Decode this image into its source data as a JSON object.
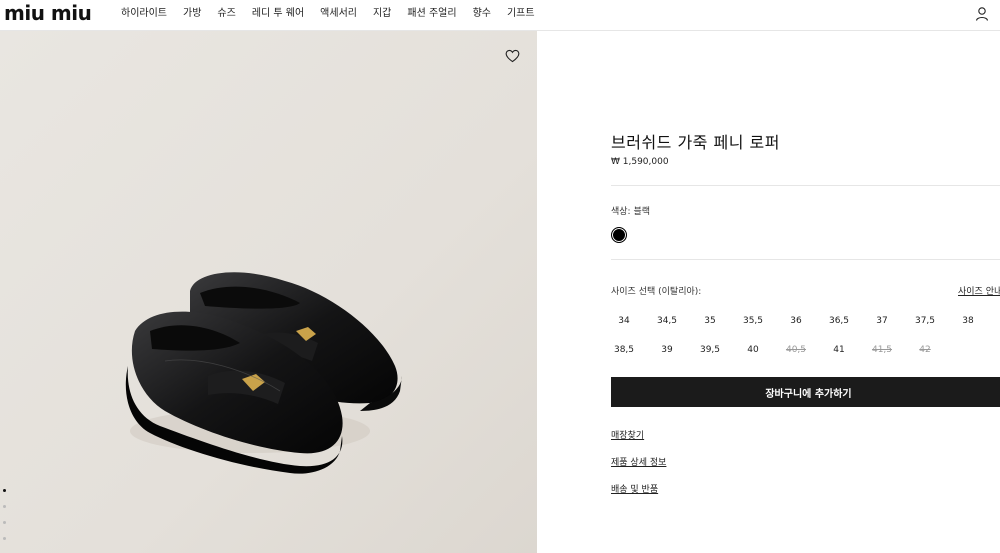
{
  "header": {
    "logo": "miu miu",
    "nav": [
      "하이라이트",
      "가방",
      "슈즈",
      "레디 투 웨어",
      "액세서리",
      "지갑",
      "패션 주얼리",
      "향수",
      "기프트"
    ]
  },
  "product": {
    "title": "브러쉬드 가죽 페니 로퍼",
    "price": "₩ 1,590,000",
    "color_label": "색상: 블랙",
    "color_hex": "#000000",
    "size_label": "사이즈 선택 (이탈리아):",
    "size_guide": "사이즈 안내",
    "sizes": [
      {
        "label": "34",
        "available": true
      },
      {
        "label": "34,5",
        "available": true
      },
      {
        "label": "35",
        "available": true
      },
      {
        "label": "35,5",
        "available": true
      },
      {
        "label": "36",
        "available": true
      },
      {
        "label": "36,5",
        "available": true
      },
      {
        "label": "37",
        "available": true
      },
      {
        "label": "37,5",
        "available": true
      },
      {
        "label": "38",
        "available": true
      },
      {
        "label": "38,5",
        "available": true
      },
      {
        "label": "39",
        "available": true
      },
      {
        "label": "39,5",
        "available": true
      },
      {
        "label": "40",
        "available": true
      },
      {
        "label": "40,5",
        "available": false
      },
      {
        "label": "41",
        "available": true
      },
      {
        "label": "41,5",
        "available": false
      },
      {
        "label": "42",
        "available": false
      }
    ],
    "add_to_cart": "장바구니에 추가하기",
    "links": [
      "매장찾기",
      "제품 상세 정보",
      "배송 및 반품"
    ]
  },
  "gallery": {
    "slide_count": 4,
    "active_slide": 1
  }
}
